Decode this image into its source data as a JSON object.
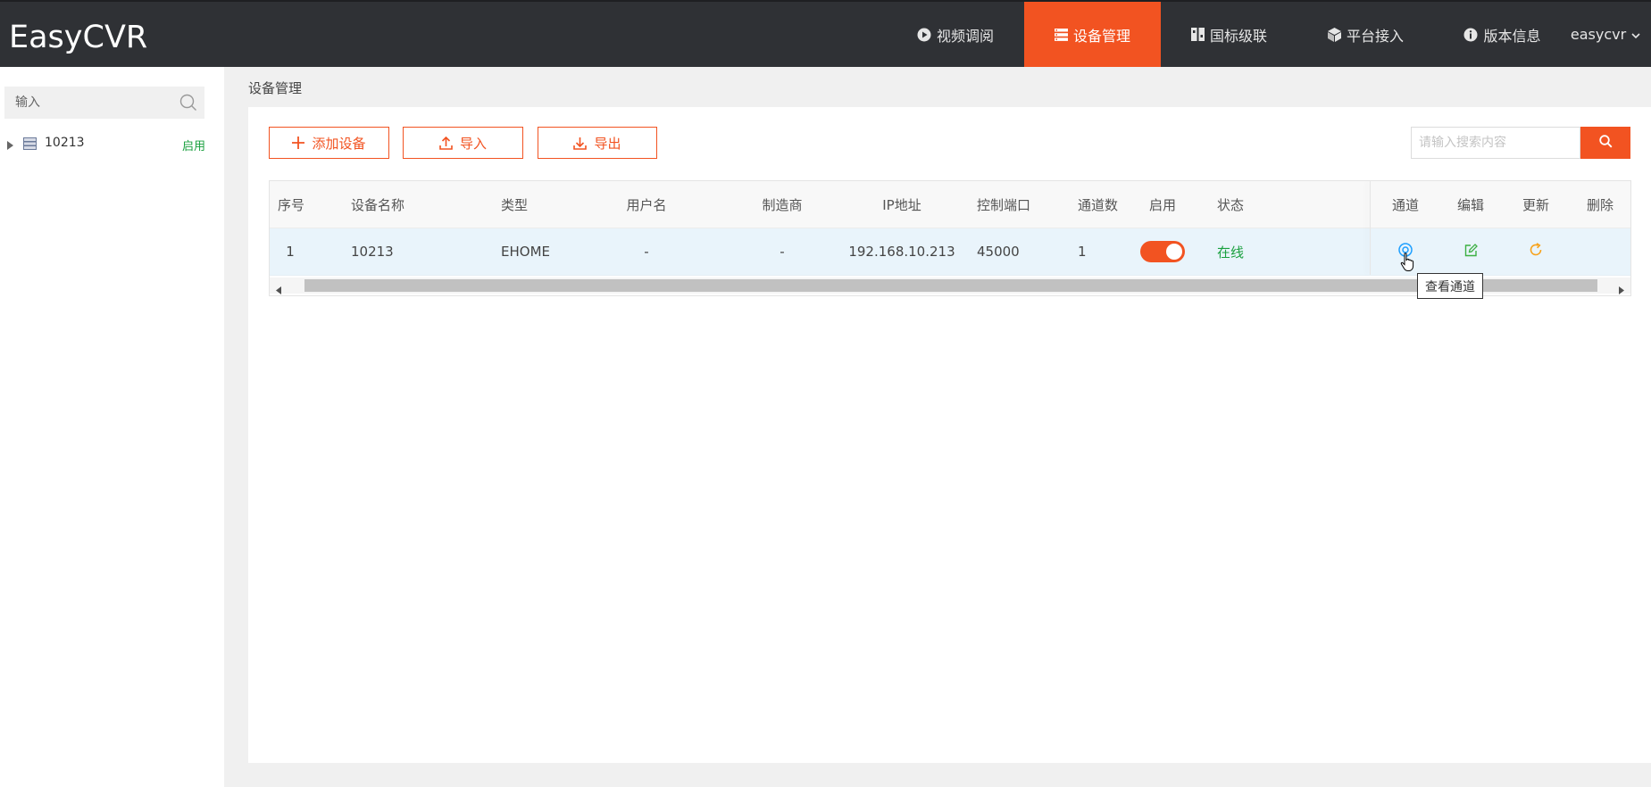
{
  "app": {
    "logo": "EasyCVR"
  },
  "nav": {
    "items": [
      {
        "label": "视频调阅",
        "icon": "play-circle-icon",
        "active": false
      },
      {
        "label": "设备管理",
        "icon": "list-icon",
        "active": true
      },
      {
        "label": "国标级联",
        "icon": "grid-icon",
        "active": false
      },
      {
        "label": "平台接入",
        "icon": "cube-icon",
        "active": false
      },
      {
        "label": "版本信息",
        "icon": "info-icon",
        "active": false
      }
    ],
    "user": "easycvr"
  },
  "sidebar": {
    "search_placeholder": "输入",
    "tree": [
      {
        "name": "10213",
        "badge": "启用"
      }
    ]
  },
  "breadcrumb": "设备管理",
  "toolbar": {
    "add_label": "添加设备",
    "import_label": "导入",
    "export_label": "导出",
    "search_placeholder": "请输入搜索内容"
  },
  "table": {
    "headers": {
      "index": "序号",
      "name": "设备名称",
      "type": "类型",
      "username": "用户名",
      "vendor": "制造商",
      "ip": "IP地址",
      "port": "控制端口",
      "channels": "通道数",
      "enable": "启用",
      "status": "状态",
      "channel": "通道",
      "edit": "编辑",
      "update": "更新",
      "delete": "删除"
    },
    "rows": [
      {
        "index": "1",
        "name": "10213",
        "type": "EHOME",
        "username": "-",
        "vendor": "-",
        "ip": "192.168.10.213",
        "port": "45000",
        "channels": "1",
        "enabled": true,
        "status": "在线"
      }
    ]
  },
  "tooltip": "查看通道",
  "colors": {
    "accent": "#f25321",
    "topbar": "#2f3135",
    "online": "#1aa03f",
    "channel_icon": "#1e9fff",
    "edit_icon": "#3cb043",
    "update_icon": "#f7a21b"
  }
}
